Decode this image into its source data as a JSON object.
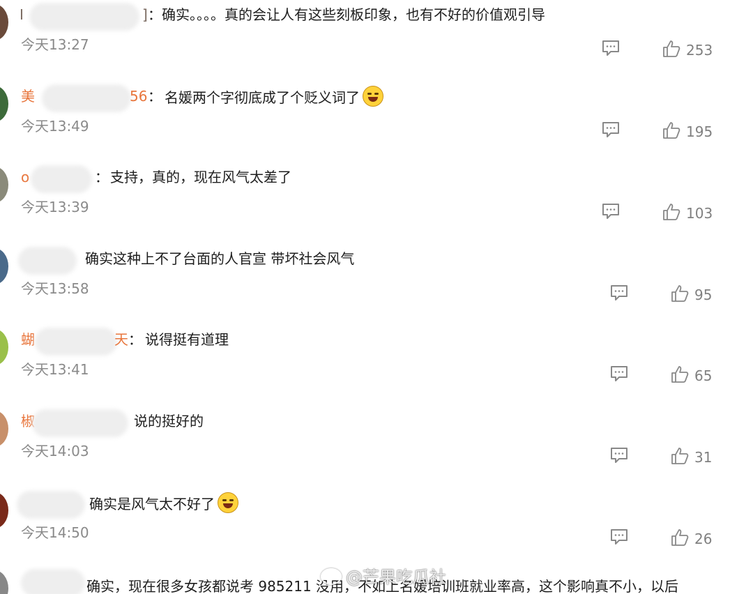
{
  "colors": {
    "username": "#e8763d",
    "time": "#8a8a8a",
    "count": "#808080"
  },
  "comments": [
    {
      "name_prefix": "I",
      "name_suffix": "]",
      "colon": "：",
      "text": "确实。。。。真的会让人有这些刻板印象，也有不好的价值观引导",
      "time": "今天13:27",
      "likes": "253",
      "avatar_color": "#6a4a3a"
    },
    {
      "name_prefix": "美",
      "name_suffix": "56",
      "colon": "：",
      "text": "名媛两个字彻底成了个贬义词了",
      "emoji": "laugh-cry-icon",
      "time": "今天13:49",
      "likes": "195",
      "avatar_color": "#3d6b3a"
    },
    {
      "name_prefix": "o",
      "name_suffix": "",
      "colon": "：",
      "text": "支持，真的，现在风气太差了",
      "time": "今天13:39",
      "likes": "103",
      "avatar_color": "#8a8a7a"
    },
    {
      "name_prefix": "",
      "name_suffix": "",
      "colon": "",
      "text": "确实这种上不了台面的人官宣 带坏社会风气",
      "time": "今天13:58",
      "likes": "95",
      "avatar_color": "#4a6a8a"
    },
    {
      "name_prefix": "蝴",
      "name_suffix": "天",
      "colon": "：",
      "text": "说得挺有道理",
      "time": "今天13:41",
      "likes": "65",
      "avatar_color": "#9ac04a"
    },
    {
      "name_prefix": "椒",
      "name_suffix": "",
      "colon": "",
      "text": "说的挺好的",
      "time": "今天14:03",
      "likes": "31",
      "avatar_color": "#c8906a"
    },
    {
      "name_prefix": "",
      "name_suffix": "",
      "colon": "",
      "text": "确实是风气太不好了",
      "emoji": "laughing-icon",
      "time": "今天14:50",
      "likes": "26",
      "avatar_color": "#7a2a1a"
    },
    {
      "name_prefix": "",
      "name_suffix": "",
      "colon": "",
      "text": "确实，现在很多女孩都说考 985211 没用，不如上名媛培训班就业率高，这个影响真不小，以后",
      "time": "",
      "likes": "",
      "avatar_color": "#888888"
    }
  ],
  "watermark": "@芒果吃瓜社"
}
